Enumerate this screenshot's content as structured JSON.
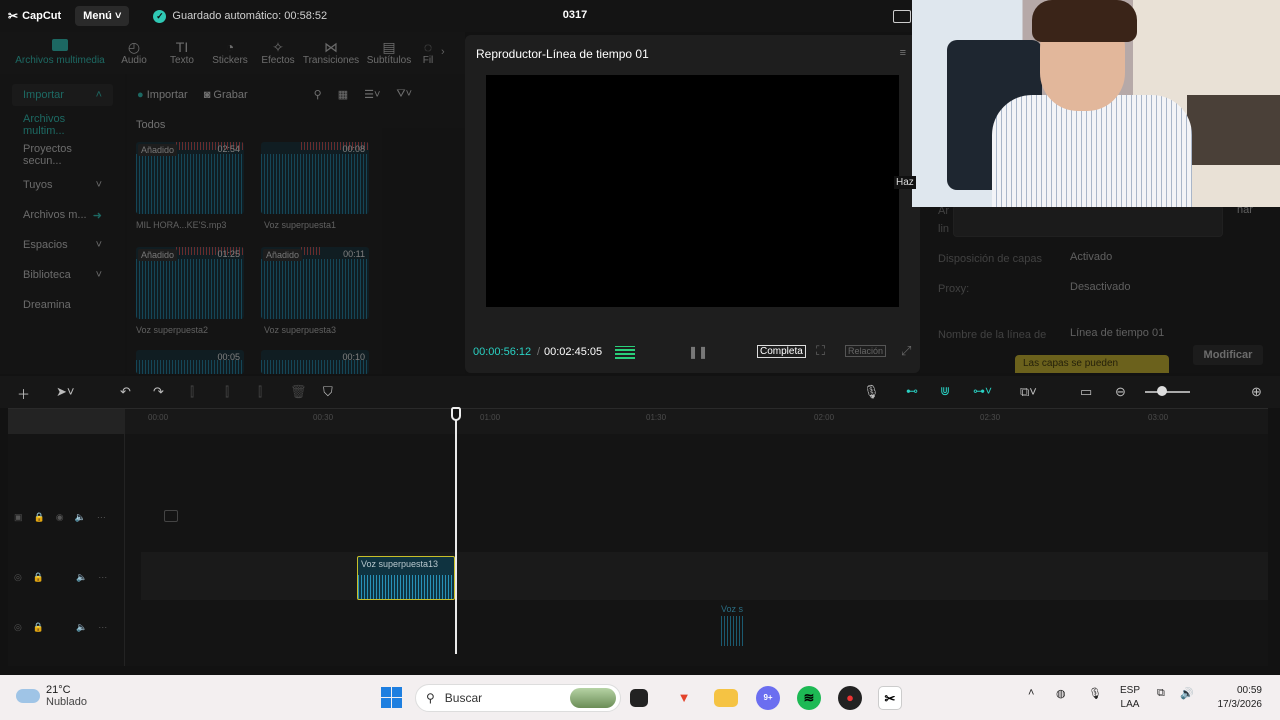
{
  "app": {
    "logo_text": "CapCut",
    "menu_label": "Menú",
    "autosave": "Guardado automático: 00:58:52",
    "project_title": "0317"
  },
  "tabs": [
    {
      "label": "Archivos multimedia",
      "icon": "media-icon"
    },
    {
      "label": "Audio",
      "icon": "audio-icon"
    },
    {
      "label": "Texto",
      "icon": "text-icon"
    },
    {
      "label": "Stickers",
      "icon": "sticker-icon"
    },
    {
      "label": "Efectos",
      "icon": "effects-icon"
    },
    {
      "label": "Transiciones",
      "icon": "transitions-icon"
    },
    {
      "label": "Subtítulos",
      "icon": "subtitles-icon"
    },
    {
      "label": "Fil",
      "icon": "filters-icon"
    }
  ],
  "sidenav": [
    {
      "label": "Importar"
    },
    {
      "label": "Archivos multim..."
    },
    {
      "label": "Proyectos secun..."
    },
    {
      "label": "Tuyos"
    },
    {
      "label": "Archivos m..."
    },
    {
      "label": "Espacios"
    },
    {
      "label": "Biblioteca"
    },
    {
      "label": "Dreamina"
    }
  ],
  "media": {
    "import_btn": "Importar",
    "record_btn": "Grabar",
    "section_all": "Todos",
    "items": [
      {
        "tag": "Añadido",
        "duration": "02:54",
        "caption": "MIL HORA...KE'S.mp3"
      },
      {
        "tag": "",
        "duration": "00:08",
        "caption": "Voz superpuesta1"
      },
      {
        "tag": "Añadido",
        "duration": "01:25",
        "caption": "Voz superpuesta2"
      },
      {
        "tag": "Añadido",
        "duration": "00:11",
        "caption": "Voz superpuesta3"
      },
      {
        "tag": "",
        "duration": "00:05",
        "caption": ""
      },
      {
        "tag": "",
        "duration": "00:10",
        "caption": ""
      }
    ]
  },
  "player": {
    "title": "Reproductor-Línea de tiempo 01",
    "current_time": "00:00:56:12",
    "separator": "/",
    "total_time": "00:02:45:05",
    "complete_btn": "Completa",
    "ratio_btn": "Relación"
  },
  "properties": {
    "row1_label": "Disposición de capas",
    "row1_value": "Activado",
    "row2_label": "Proxy:",
    "row2_value": "Desactivado",
    "row3_label": "Nombre de la línea de",
    "row3_value": "Línea de tiempo 01",
    "tooltip_text": "Las capas se pueden",
    "modify_btn": "Modificar",
    "partial_left_1": "Ar",
    "partial_left_2": "lin",
    "partial_right": "nar",
    "haz": "Haz"
  },
  "timeline": {
    "clip_name": "Voz superpuesta13",
    "ghost_clip_name": "Voz s",
    "ruler_labels": [
      "00:00",
      "00:30",
      "01:00",
      "01:30",
      "02:00",
      "02:30",
      "03:00"
    ]
  },
  "taskbar": {
    "temp": "21°C",
    "weather": "Nublado",
    "search_placeholder": "Buscar",
    "lang_1": "ESP",
    "lang_2": "LAA",
    "time": "00:59",
    "date": "17/3/2026",
    "discord_badge": "9+"
  },
  "colors": {
    "accent": "#2ad1c3",
    "clip_border": "#c8bf2a",
    "tooltip": "#d8c22a"
  }
}
